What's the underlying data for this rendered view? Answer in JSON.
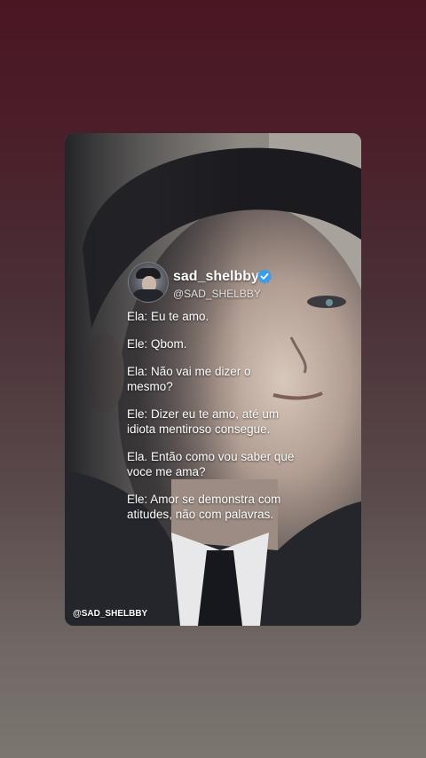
{
  "post": {
    "username": "sad_shelbby",
    "handle": "@SAD_SHELBBY",
    "lines": [
      "Ela: Eu te amo.",
      "Ele: Qbom.",
      "Ela: Não vai me dizer o\n mesmo?",
      "Ele: Dizer eu te amo, até um\nidiota mentiroso consegue.",
      "Ela. Então como vou saber que\n voce me ama?",
      "Ele: Amor se demonstra com\n atitudes, não com palavras."
    ]
  },
  "watermark": "@SAD_SHELBBY",
  "colors": {
    "verified": "#3b9de8",
    "background_top": "#4a1622",
    "background_bottom": "#7c7670"
  },
  "icons": {
    "verified": "verified-badge-icon"
  }
}
